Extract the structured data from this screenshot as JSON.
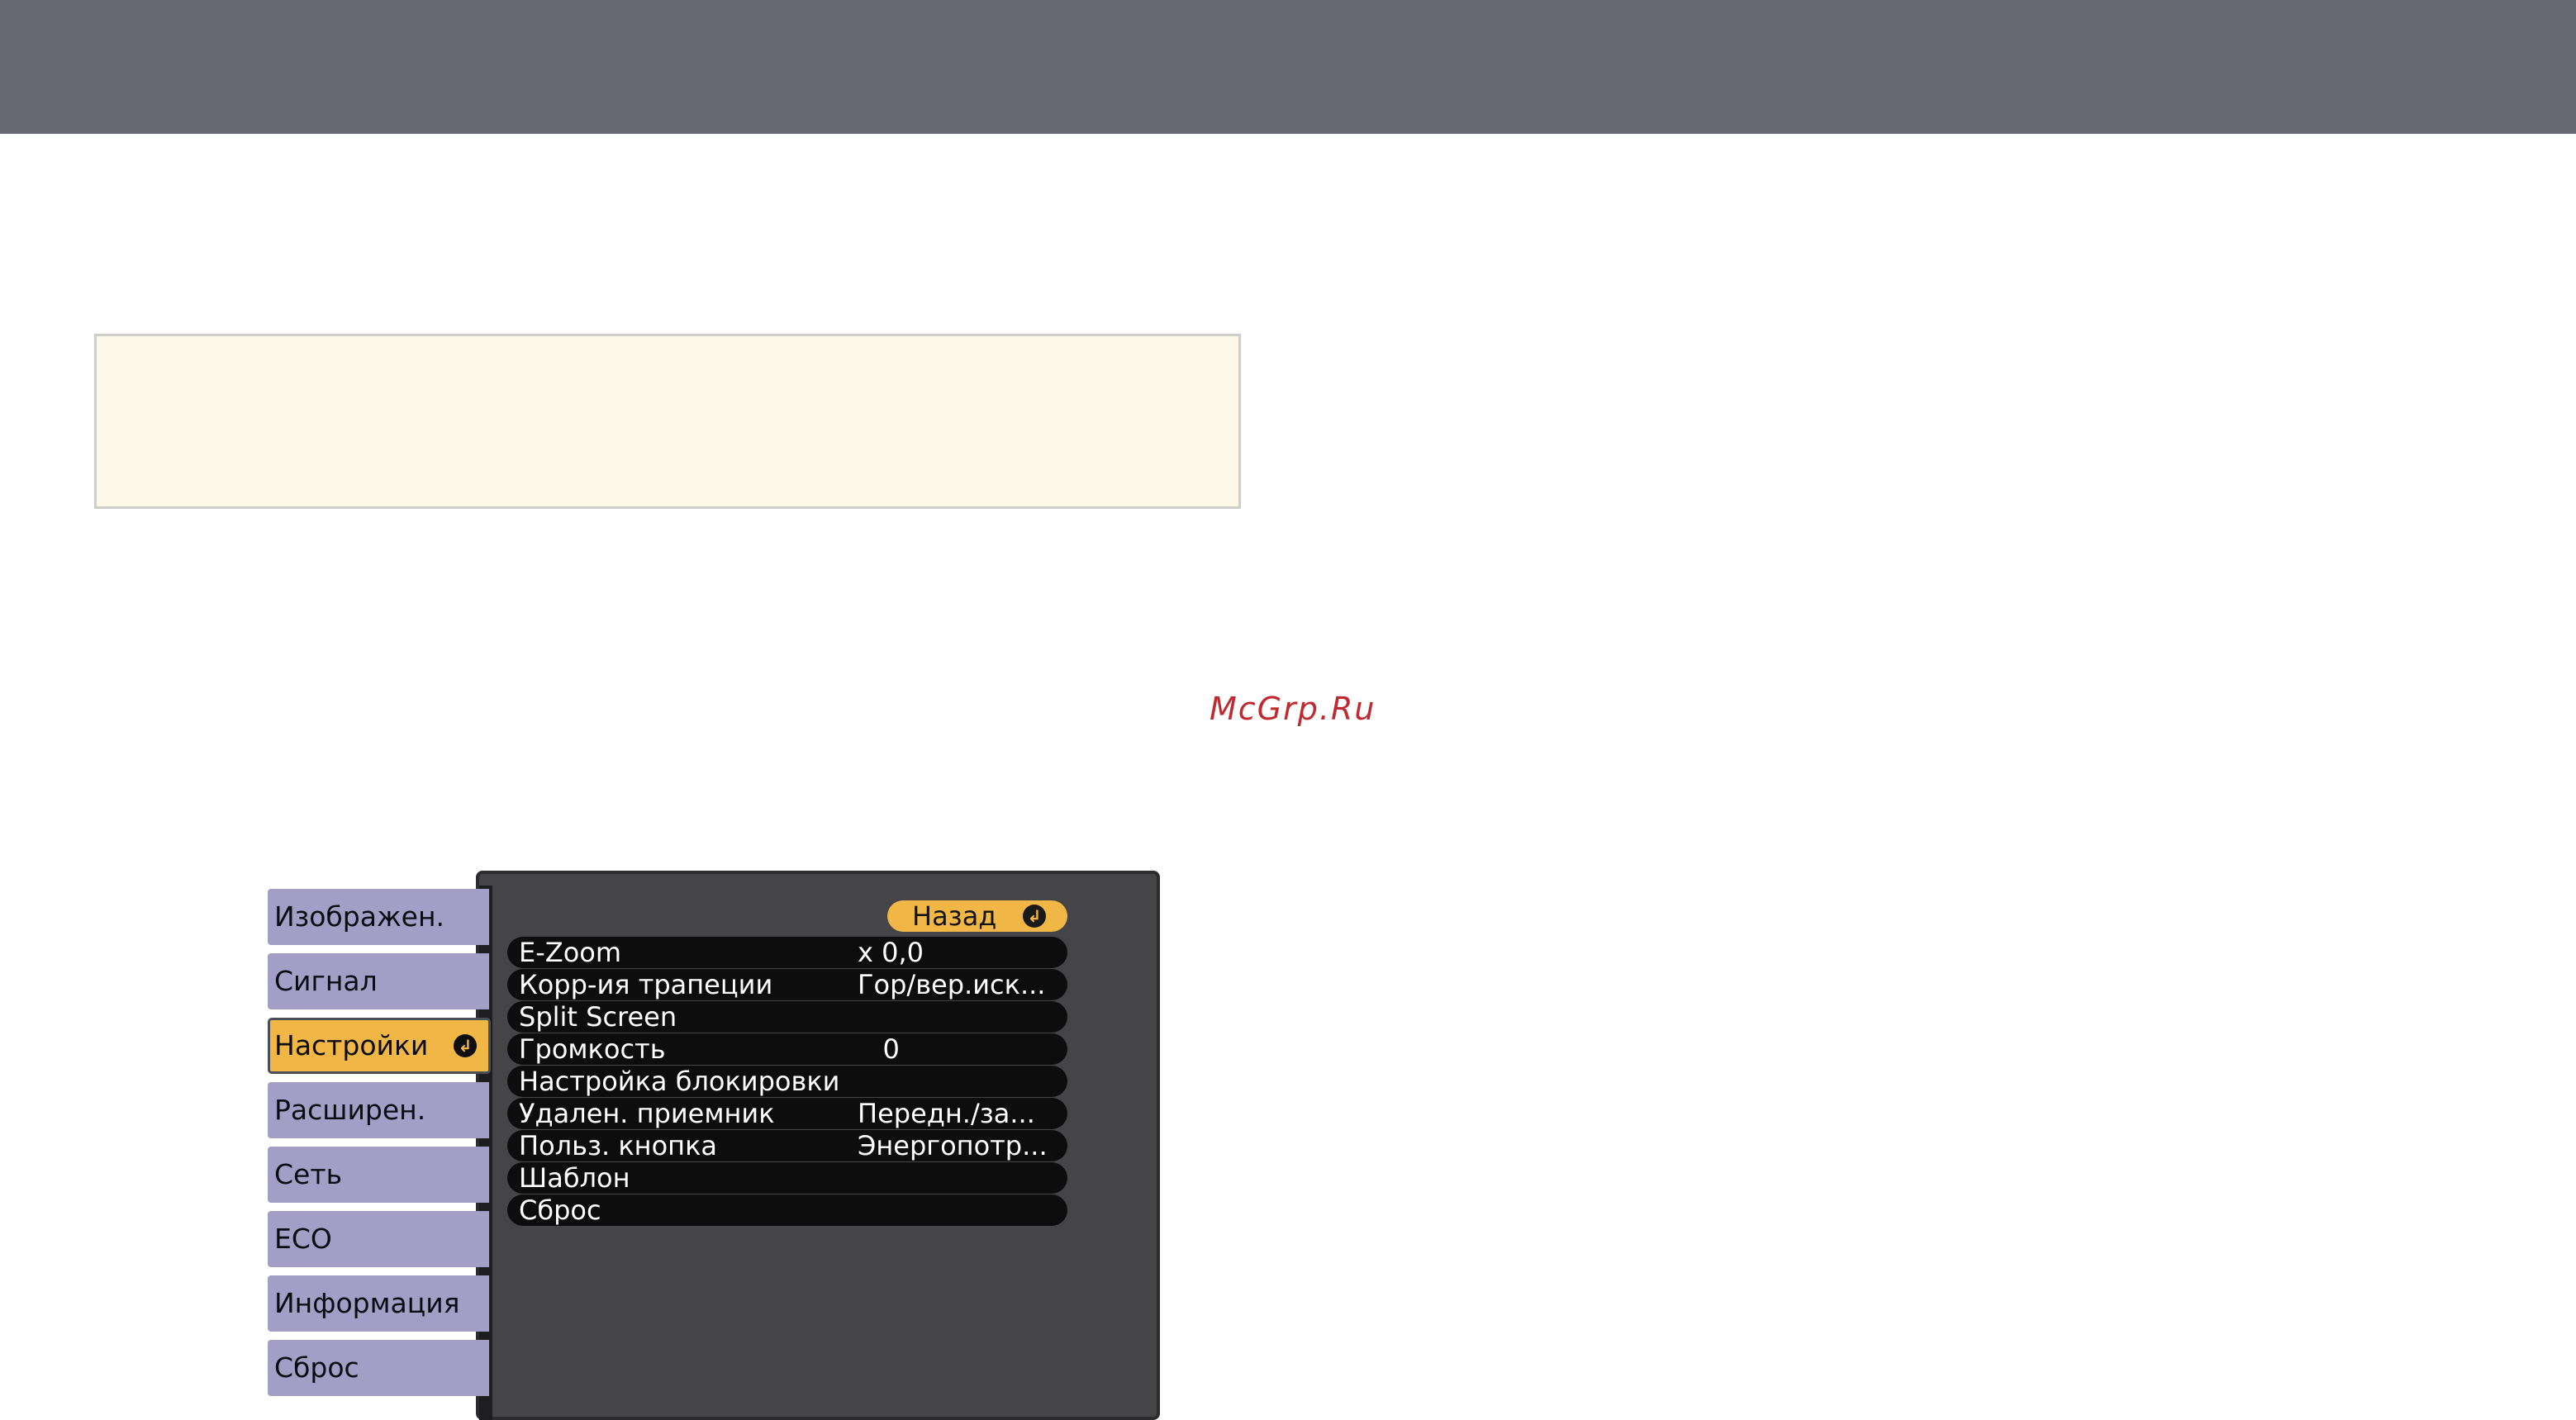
{
  "watermark": "McGrp.Ru",
  "menu": {
    "back_label": "Назад",
    "sidebar": [
      {
        "label": "Изображен.",
        "active": false
      },
      {
        "label": "Сигнал",
        "active": false
      },
      {
        "label": "Настройки",
        "active": true
      },
      {
        "label": "Расширен.",
        "active": false
      },
      {
        "label": "Сеть",
        "active": false
      },
      {
        "label": "ECO",
        "active": false
      },
      {
        "label": "Информация",
        "active": false
      },
      {
        "label": "Сброс",
        "active": false
      }
    ],
    "rows": [
      {
        "label": "E-Zoom",
        "value": "x  0,0"
      },
      {
        "label": "Корр-ия трапеции",
        "value": "Гор/вер.иск..."
      },
      {
        "label": "Split Screen",
        "value": ""
      },
      {
        "label": "Громкость",
        "value": "   0"
      },
      {
        "label": "Настройка блокировки",
        "value": ""
      },
      {
        "label": "Удален. приемник",
        "value": "Передн./за..."
      },
      {
        "label": "Польз. кнопка",
        "value": "Энергопотр..."
      },
      {
        "label": "Шаблон",
        "value": ""
      },
      {
        "label": "Сброс",
        "value": ""
      }
    ]
  },
  "icons": {
    "enter": "enter-return-icon"
  },
  "colors": {
    "accent": "#f0b646",
    "sidebar": "#a39ec6",
    "panel": "#454548",
    "topbar": "#676a73",
    "note_bg": "#fdf8e7"
  }
}
